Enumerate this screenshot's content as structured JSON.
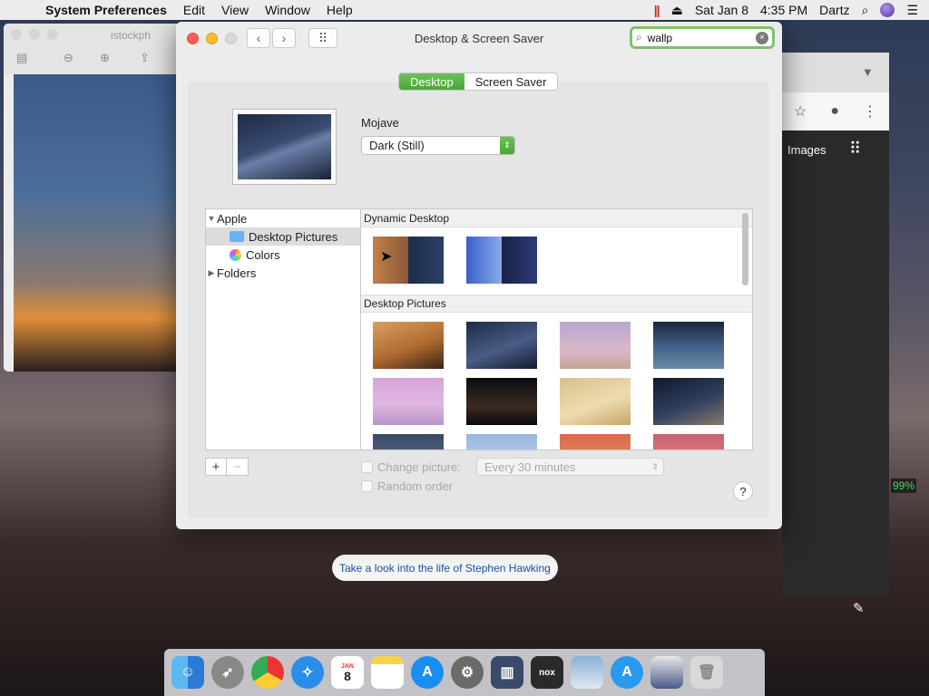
{
  "menubar": {
    "app": "System Preferences",
    "items": [
      "Edit",
      "View",
      "Window",
      "Help"
    ],
    "date": "Sat Jan 8",
    "time": "4:35 PM",
    "user": "Dartz"
  },
  "background": {
    "preview_title": "istockph",
    "chrome_images_link": "Images",
    "battery_percent": "99%",
    "banner": "Take a look into the life of Stephen Hawking"
  },
  "window": {
    "title": "Desktop & Screen Saver",
    "search_value": "wallp",
    "tabs": [
      {
        "label": "Desktop",
        "active": true
      },
      {
        "label": "Screen Saver",
        "active": false
      }
    ],
    "wallpaper_name": "Mojave",
    "wallpaper_mode": "Dark (Still)",
    "sidebar": [
      {
        "label": "Apple",
        "type": "group"
      },
      {
        "label": "Desktop Pictures",
        "type": "folder",
        "selected": true
      },
      {
        "label": "Colors",
        "type": "colors"
      },
      {
        "label": "Folders",
        "type": "group"
      }
    ],
    "sections": [
      {
        "title": "Dynamic Desktop"
      },
      {
        "title": "Desktop Pictures"
      }
    ],
    "change_picture_label": "Change picture:",
    "change_interval": "Every 30 minutes",
    "random_order_label": "Random order",
    "help_label": "?",
    "add_label": "+",
    "remove_label": "−"
  },
  "dock": {
    "calendar_month": "JAN",
    "calendar_day": "8"
  },
  "colors": {
    "accent": "#49a638",
    "search_focus": "#7fc26c"
  }
}
